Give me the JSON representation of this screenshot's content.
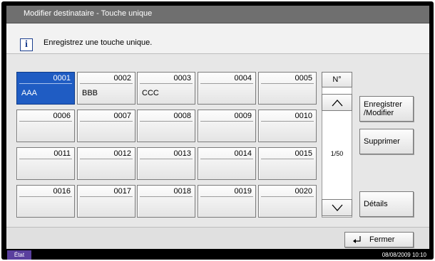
{
  "window": {
    "title": "Modifier destinataire - Touche unique"
  },
  "message": {
    "text": "Enregistrez une touche unique.",
    "icon": "info-icon"
  },
  "keys": [
    {
      "number": "0001",
      "name": "AAA",
      "selected": true
    },
    {
      "number": "0002",
      "name": "BBB",
      "selected": false
    },
    {
      "number": "0003",
      "name": "CCC",
      "selected": false
    },
    {
      "number": "0004",
      "name": "",
      "selected": false
    },
    {
      "number": "0005",
      "name": "",
      "selected": false
    },
    {
      "number": "0006",
      "name": "",
      "selected": false
    },
    {
      "number": "0007",
      "name": "",
      "selected": false
    },
    {
      "number": "0008",
      "name": "",
      "selected": false
    },
    {
      "number": "0009",
      "name": "",
      "selected": false
    },
    {
      "number": "0010",
      "name": "",
      "selected": false
    },
    {
      "number": "0011",
      "name": "",
      "selected": false
    },
    {
      "number": "0012",
      "name": "",
      "selected": false
    },
    {
      "number": "0013",
      "name": "",
      "selected": false
    },
    {
      "number": "0014",
      "name": "",
      "selected": false
    },
    {
      "number": "0015",
      "name": "",
      "selected": false
    },
    {
      "number": "0016",
      "name": "",
      "selected": false
    },
    {
      "number": "0017",
      "name": "",
      "selected": false
    },
    {
      "number": "0018",
      "name": "",
      "selected": false
    },
    {
      "number": "0019",
      "name": "",
      "selected": false
    },
    {
      "number": "0020",
      "name": "",
      "selected": false
    }
  ],
  "nav": {
    "number_label": "N°",
    "page_indicator": "1/50",
    "up_icon": "chevron-up-icon",
    "down_icon": "chevron-down-icon"
  },
  "actions": {
    "register_modify": "Enregistrer /Modifier",
    "delete": "Supprimer",
    "details": "Détails"
  },
  "footer": {
    "close_label": "Fermer",
    "close_icon": "return-arrow-icon"
  },
  "status": {
    "badge": "État",
    "datetime": "08/08/2009   10:10"
  },
  "colors": {
    "selected_key": "#1f5cc3",
    "title_bar": "#6f6f6f",
    "status_badge": "#5a3f9e"
  }
}
